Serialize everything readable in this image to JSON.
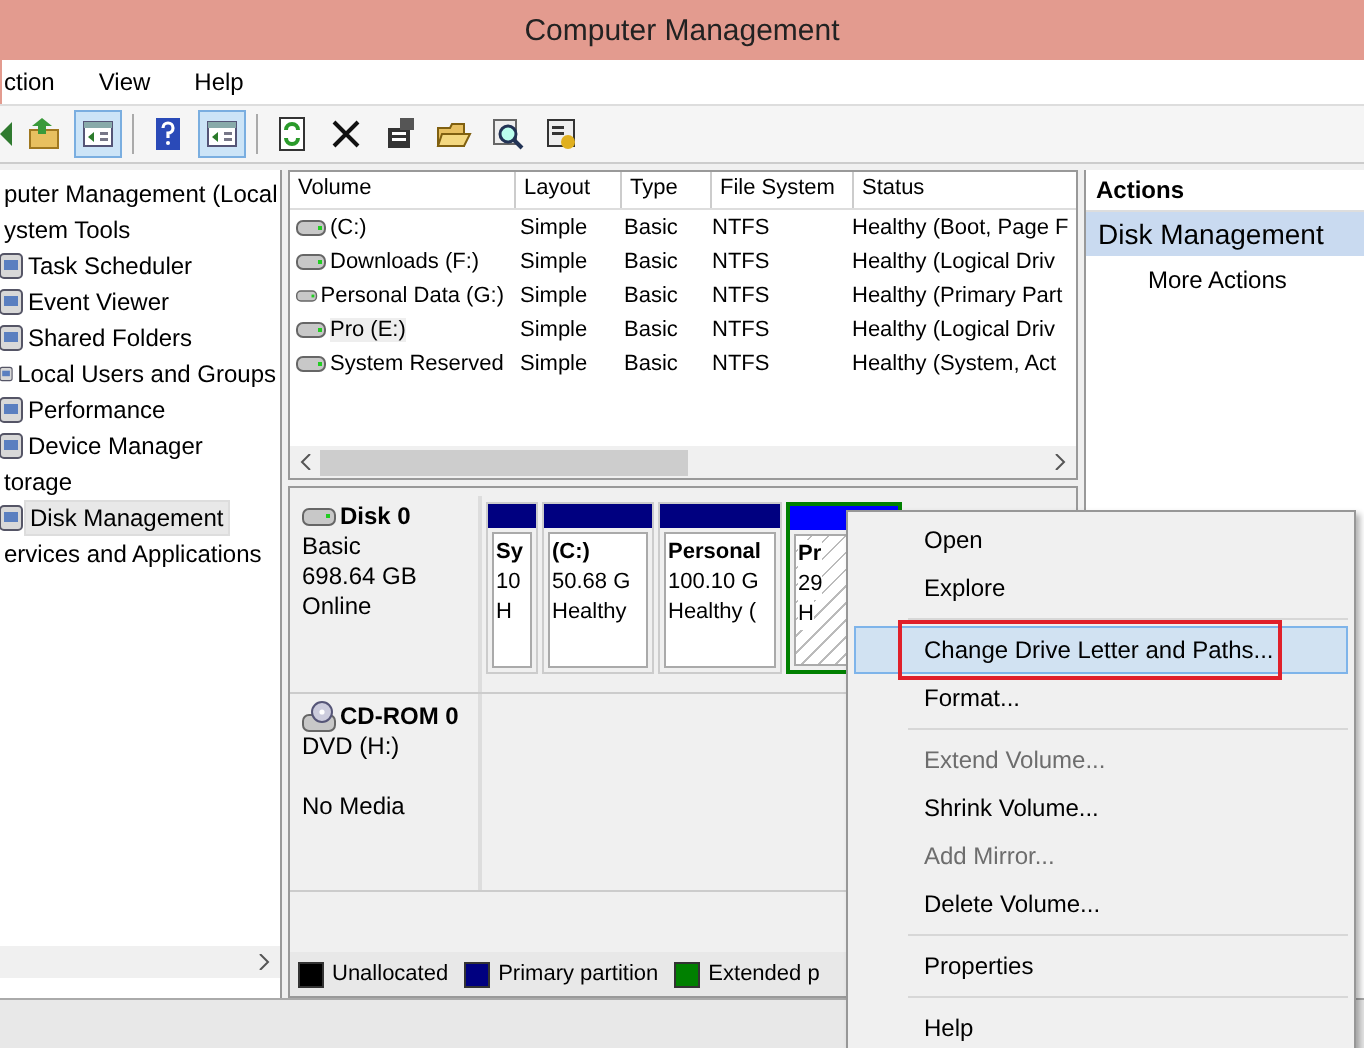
{
  "window": {
    "title": "Computer Management"
  },
  "menu_bar": [
    "ction",
    "View",
    "Help"
  ],
  "toolbar": [
    {
      "kind": "up",
      "pressed": false
    },
    {
      "kind": "pane",
      "pressed": true
    },
    {
      "kind": "help",
      "pressed": false
    },
    {
      "kind": "pane",
      "pressed": true
    },
    {
      "kind": "refresh",
      "pressed": false
    },
    {
      "kind": "delete",
      "pressed": false
    },
    {
      "kind": "properties",
      "pressed": false
    },
    {
      "kind": "open",
      "pressed": false
    },
    {
      "kind": "search",
      "pressed": false
    },
    {
      "kind": "settings",
      "pressed": false
    }
  ],
  "tree": [
    {
      "label": "puter Management (Local",
      "selected": false,
      "children": [
        {
          "label": "ystem Tools",
          "selected": false,
          "children": [
            {
              "label": "Task Scheduler",
              "selected": false
            },
            {
              "label": "Event Viewer",
              "selected": false
            },
            {
              "label": "Shared Folders",
              "selected": false
            },
            {
              "label": "Local Users and Groups",
              "selected": false
            },
            {
              "label": "Performance",
              "selected": false
            },
            {
              "label": "Device Manager",
              "selected": false
            }
          ]
        },
        {
          "label": "torage",
          "selected": false,
          "children": [
            {
              "label": "Disk Management",
              "selected": true
            }
          ]
        },
        {
          "label": "ervices and Applications",
          "selected": false
        }
      ]
    }
  ],
  "volume_table": {
    "columns": [
      "Volume",
      "Layout",
      "Type",
      "File System",
      "Status"
    ],
    "rows": [
      {
        "cells": [
          " (C:)",
          "Simple",
          "Basic",
          "NTFS",
          "Healthy (Boot, Page F"
        ],
        "selected": false
      },
      {
        "cells": [
          "Downloads (F:)",
          "Simple",
          "Basic",
          "NTFS",
          "Healthy (Logical Driv"
        ],
        "selected": false
      },
      {
        "cells": [
          "Personal Data (G:)",
          "Simple",
          "Basic",
          "NTFS",
          "Healthy (Primary Part"
        ],
        "selected": false
      },
      {
        "cells": [
          "Pro (E:)",
          "Simple",
          "Basic",
          "NTFS",
          "Healthy (Logical Driv"
        ],
        "selected": true
      },
      {
        "cells": [
          "System Reserved",
          "Simple",
          "Basic",
          "NTFS",
          "Healthy (System, Act"
        ],
        "selected": false
      }
    ]
  },
  "disks": [
    {
      "name": "Disk 0",
      "lines": [
        "Basic",
        "698.64 GB",
        "Online"
      ],
      "kind": "hdd",
      "partitions": [
        {
          "lines": [
            "Sy",
            "10",
            "H"
          ],
          "kind": "primary",
          "selected": false
        },
        {
          "lines": [
            "(C:)",
            "50.68 G",
            "Healthy"
          ],
          "kind": "primary",
          "selected": false
        },
        {
          "lines": [
            "Personal",
            "100.10 G",
            "Healthy ("
          ],
          "kind": "primary",
          "selected": false
        },
        {
          "lines": [
            "Pr",
            "29",
            "H"
          ],
          "kind": "logical",
          "selected": true
        }
      ]
    },
    {
      "name": "CD-ROM 0",
      "lines": [
        "DVD (H:)",
        "No Media"
      ],
      "kind": "cdrom"
    }
  ],
  "legend": [
    {
      "label": "Unallocated",
      "color": "#000000"
    },
    {
      "label": "Primary partition",
      "color": "#000080"
    },
    {
      "label": "Extended p",
      "color": "#008000"
    }
  ],
  "actions": {
    "header": "Actions",
    "section": "Disk Management",
    "items": [
      "More Actions"
    ]
  },
  "context_menu": [
    {
      "kind": "item",
      "label": "Open",
      "disabled": false,
      "selected": false,
      "marked": false
    },
    {
      "kind": "item",
      "label": "Explore",
      "disabled": false,
      "selected": false,
      "marked": false
    },
    {
      "kind": "separator"
    },
    {
      "kind": "item",
      "label": "Change Drive Letter and Paths...",
      "disabled": false,
      "selected": true,
      "marked": true
    },
    {
      "kind": "item",
      "label": "Format...",
      "disabled": false,
      "selected": false,
      "marked": false
    },
    {
      "kind": "separator"
    },
    {
      "kind": "item",
      "label": "Extend Volume...",
      "disabled": true,
      "selected": false,
      "marked": false
    },
    {
      "kind": "item",
      "label": "Shrink Volume...",
      "disabled": false,
      "selected": false,
      "marked": false
    },
    {
      "kind": "item",
      "label": "Add Mirror...",
      "disabled": true,
      "selected": false,
      "marked": false
    },
    {
      "kind": "item",
      "label": "Delete Volume...",
      "disabled": false,
      "selected": false,
      "marked": false
    },
    {
      "kind": "separator"
    },
    {
      "kind": "item",
      "label": "Properties",
      "disabled": false,
      "selected": false,
      "marked": false
    },
    {
      "kind": "separator"
    },
    {
      "kind": "item",
      "label": "Help",
      "disabled": false,
      "selected": false,
      "marked": false
    }
  ]
}
